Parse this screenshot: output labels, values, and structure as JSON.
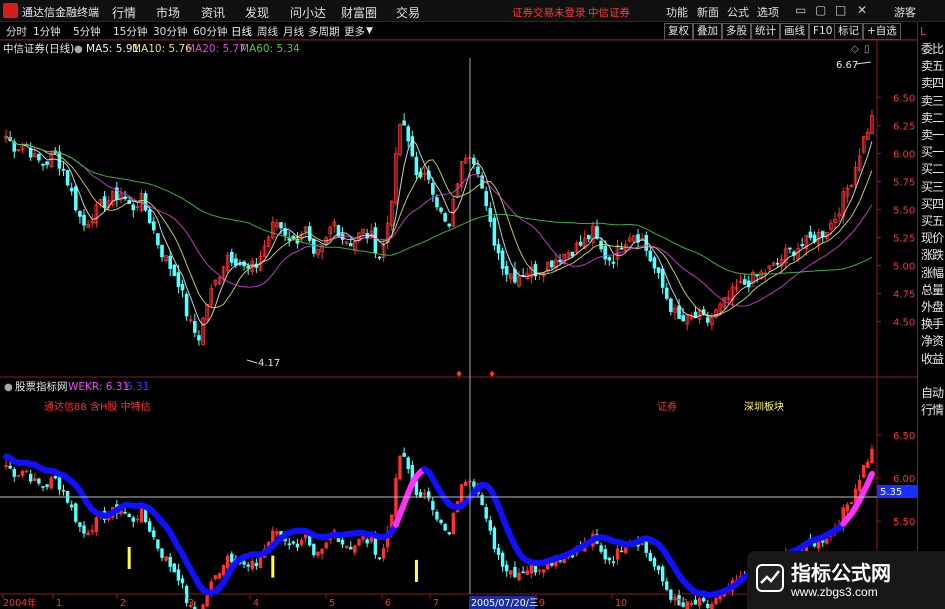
{
  "menubar": {
    "app_name": "通达信金融终端",
    "items": [
      "行情",
      "市场",
      "资讯",
      "发现",
      "问小达",
      "财富圈",
      "交易"
    ],
    "warning": "证券交易未登录",
    "broker": "中信证券",
    "right_items": [
      "功能",
      "新面",
      "公式",
      "选项"
    ],
    "guest": "游客"
  },
  "toolbar": {
    "periods": [
      "分时",
      "1分钟",
      "5分钟",
      "15分钟",
      "30分钟",
      "60分钟",
      "日线",
      "周线",
      "月线",
      "多周期",
      "更多"
    ],
    "right_buttons": [
      "复权",
      "叠加",
      "多股",
      "统计",
      "画线",
      "F10",
      "标记",
      "+自选"
    ]
  },
  "right_panel": {
    "items": [
      "委比",
      "卖五",
      "卖四",
      "卖三",
      "卖二",
      "卖一",
      "买一",
      "买二",
      "买三",
      "买四",
      "买五",
      "现价",
      "涨跌",
      "涨幅",
      "总量",
      "外盘",
      "换手",
      "净资",
      "收益"
    ],
    "lower_items": [
      "自动",
      "行情"
    ],
    "top_label": "L"
  },
  "main_chart": {
    "title": "中信证券(日线)",
    "ma_legend": [
      {
        "label": "MA5: 5.91",
        "color": "#f0f0f0"
      },
      {
        "label": "MA10: 5.76",
        "color": "#e8e85a"
      },
      {
        "label": "MA20: 5.77",
        "color": "#e040e0"
      },
      {
        "label": "MA60: 5.34",
        "color": "#40d040"
      }
    ],
    "high_label": "6.67",
    "low_label": "4.17",
    "y_ticks": [
      "6.50",
      "6.25",
      "6.00",
      "5.75",
      "5.50",
      "5.25",
      "5.00",
      "4.75",
      "4.50"
    ],
    "y_range": [
      4.05,
      6.85
    ]
  },
  "indicator_chart": {
    "title": "股票指标网",
    "legend_name": "WEKR: 6.31",
    "legend_value": "6.31",
    "subtitle": "通达信88 含H股 中特估",
    "label_red": "证券",
    "label_yellow": "深圳板块",
    "price_box": "5.35",
    "y_ticks": [
      "6.50",
      "6.00",
      "5.50",
      "5.00"
    ]
  },
  "x_axis": {
    "labels": [
      "2004年",
      "1",
      "2",
      "3",
      "4",
      "5",
      "6",
      "7",
      "8",
      "9",
      "10",
      "11"
    ],
    "cursor_date": "2005/07/20/三"
  },
  "watermark": {
    "title": "指标公式网",
    "url": "www.zbgs3.com"
  },
  "colors": {
    "up": "#ff3030",
    "down": "#54ffff",
    "blue_band": "#1010ff",
    "magenta_band": "#ff30ff",
    "border": "#8a1a1a"
  },
  "chart_data": {
    "type": "candlestick",
    "title": "中信证券(日线)",
    "series": [
      {
        "name": "MA5",
        "last": 5.91
      },
      {
        "name": "MA10",
        "last": 5.76
      },
      {
        "name": "MA20",
        "last": 5.77
      },
      {
        "name": "MA60",
        "last": 5.34
      }
    ],
    "ylim": [
      4.05,
      6.85
    ],
    "y_ticks": [
      6.5,
      6.25,
      6.0,
      5.75,
      5.5,
      5.25,
      5.0,
      4.75,
      4.5
    ],
    "close_path": [
      6.15,
      6.05,
      6.1,
      5.95,
      5.9,
      6.0,
      5.85,
      5.6,
      5.35,
      5.45,
      5.55,
      5.6,
      5.65,
      5.5,
      5.6,
      5.4,
      5.15,
      5.0,
      4.85,
      4.5,
      4.35,
      4.7,
      4.9,
      5.1,
      5.05,
      4.95,
      5.0,
      5.2,
      5.4,
      5.3,
      5.2,
      5.35,
      5.05,
      5.15,
      5.4,
      5.25,
      5.2,
      5.3,
      5.25,
      5.05,
      5.55,
      6.3,
      6.05,
      5.75,
      5.8,
      5.5,
      5.3,
      5.8,
      6.05,
      5.9,
      5.45,
      5.15,
      4.95,
      4.9,
      4.95,
      4.95,
      5.0,
      5.05,
      5.1,
      5.15,
      5.2,
      5.3,
      5.1,
      5.05,
      5.2,
      5.3,
      5.25,
      5.05,
      4.85,
      4.65,
      4.5,
      4.52,
      4.55,
      4.5,
      4.6,
      4.7,
      4.8,
      4.85,
      4.9,
      4.95,
      5.0,
      5.1,
      5.15,
      5.2,
      5.25,
      5.3,
      5.4,
      5.6,
      5.8,
      6.1,
      6.31
    ],
    "high": 6.67,
    "low": 4.17,
    "indicator": {
      "name": "WEKR",
      "value": 6.31
    }
  }
}
